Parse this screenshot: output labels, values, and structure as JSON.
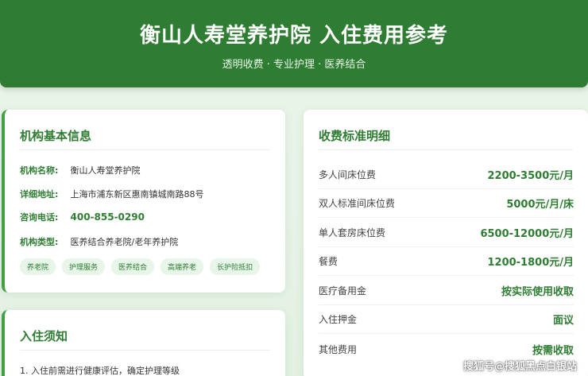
{
  "header": {
    "title": "衡山人寿堂养护院 入住费用参考",
    "subtitle": "透明收费 · 专业护理 · 医养结合"
  },
  "info": {
    "heading": "机构基本信息",
    "rows": [
      {
        "label": "机构名称:",
        "value": "衡山人寿堂养护院"
      },
      {
        "label": "详细地址:",
        "value": "上海市浦东新区惠南镇城南路88号"
      },
      {
        "label": "咨询电话:",
        "value": "400-855-0290"
      },
      {
        "label": "机构类型:",
        "value": "医养结合养老院/老年养护院"
      }
    ],
    "tags": [
      "养老院",
      "护理服务",
      "医养结合",
      "高端养老",
      "长护险抵扣"
    ]
  },
  "notice": {
    "heading": "入住须知",
    "line1": "1. 入住前需进行健康评估，确定护理等级"
  },
  "fees": {
    "heading": "收费标准明细",
    "rows": [
      {
        "name": "多人间床位费",
        "price": "2200-3500元/月"
      },
      {
        "name": "双人标准间床位费",
        "price": "5000元/月/床"
      },
      {
        "name": "单人套房床位费",
        "price": "6500-12000元/月"
      },
      {
        "name": "餐费",
        "price": "1200-1800元/月"
      },
      {
        "name": "医疗备用金",
        "price": "按实际使用收取"
      },
      {
        "name": "入住押金",
        "price": "面议"
      },
      {
        "name": "其他费用",
        "price": "按需收取"
      }
    ]
  },
  "watermark": "搜狐号@搜狐黑点白银站"
}
